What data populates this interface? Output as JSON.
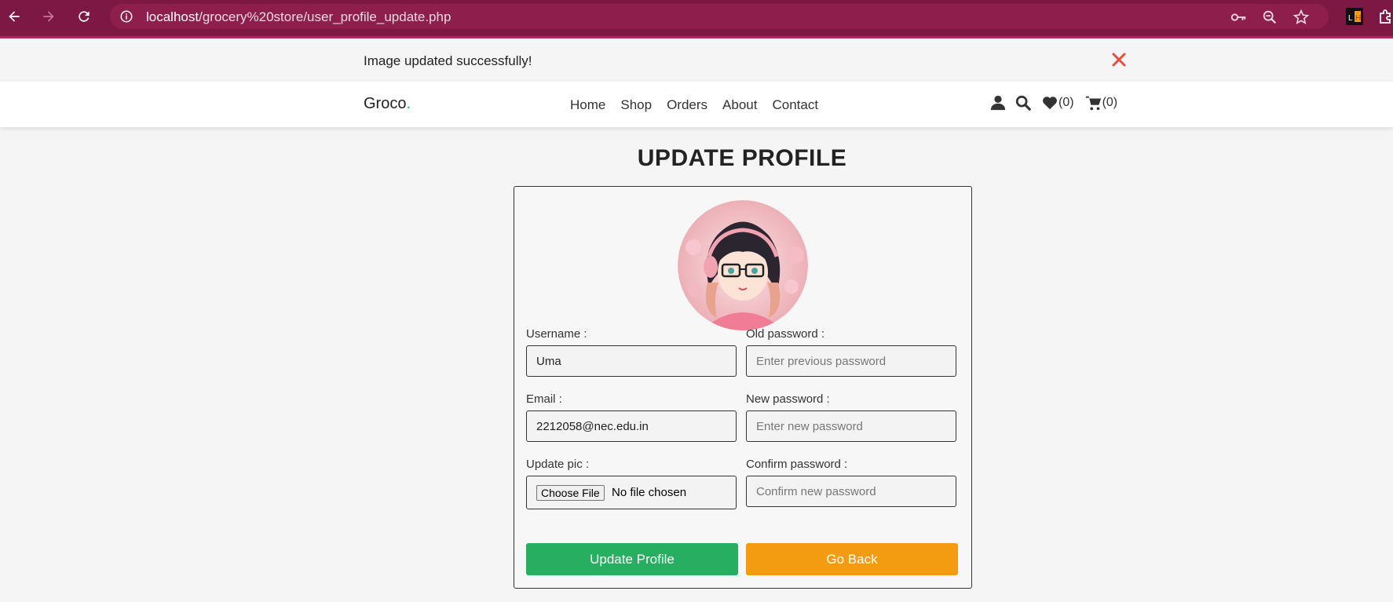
{
  "browser": {
    "url_host": "localhost",
    "url_path": "/grocery%20store/user_profile_update.php"
  },
  "alert": {
    "message": "Image updated successfully!",
    "close_icon": "close-icon"
  },
  "header": {
    "logo_text": "Groco",
    "logo_dot": ".",
    "menu": [
      "Home",
      "Shop",
      "Orders",
      "About",
      "Contact"
    ],
    "wishlist_count": "(0)",
    "cart_count": "(0)"
  },
  "page": {
    "title": "UPDATE PROFILE"
  },
  "form": {
    "username_label": "Username :",
    "username_value": "Uma",
    "email_label": "Email :",
    "email_value": "2212058@nec.edu.in",
    "update_pic_label": "Update pic :",
    "choose_file_label": "Choose File",
    "no_file_text": "No file chosen",
    "old_password_label": "Old password :",
    "old_password_placeholder": "Enter previous password",
    "new_password_label": "New password :",
    "new_password_placeholder": "Enter new password",
    "confirm_password_label": "Confirm password :",
    "confirm_password_placeholder": "Confirm new password",
    "update_button": "Update Profile",
    "back_button": "Go Back"
  },
  "colors": {
    "browser_bar": "#7d1743",
    "accent_green": "#27ae60",
    "accent_orange": "#f39c12",
    "close_red": "#e74c3c"
  }
}
